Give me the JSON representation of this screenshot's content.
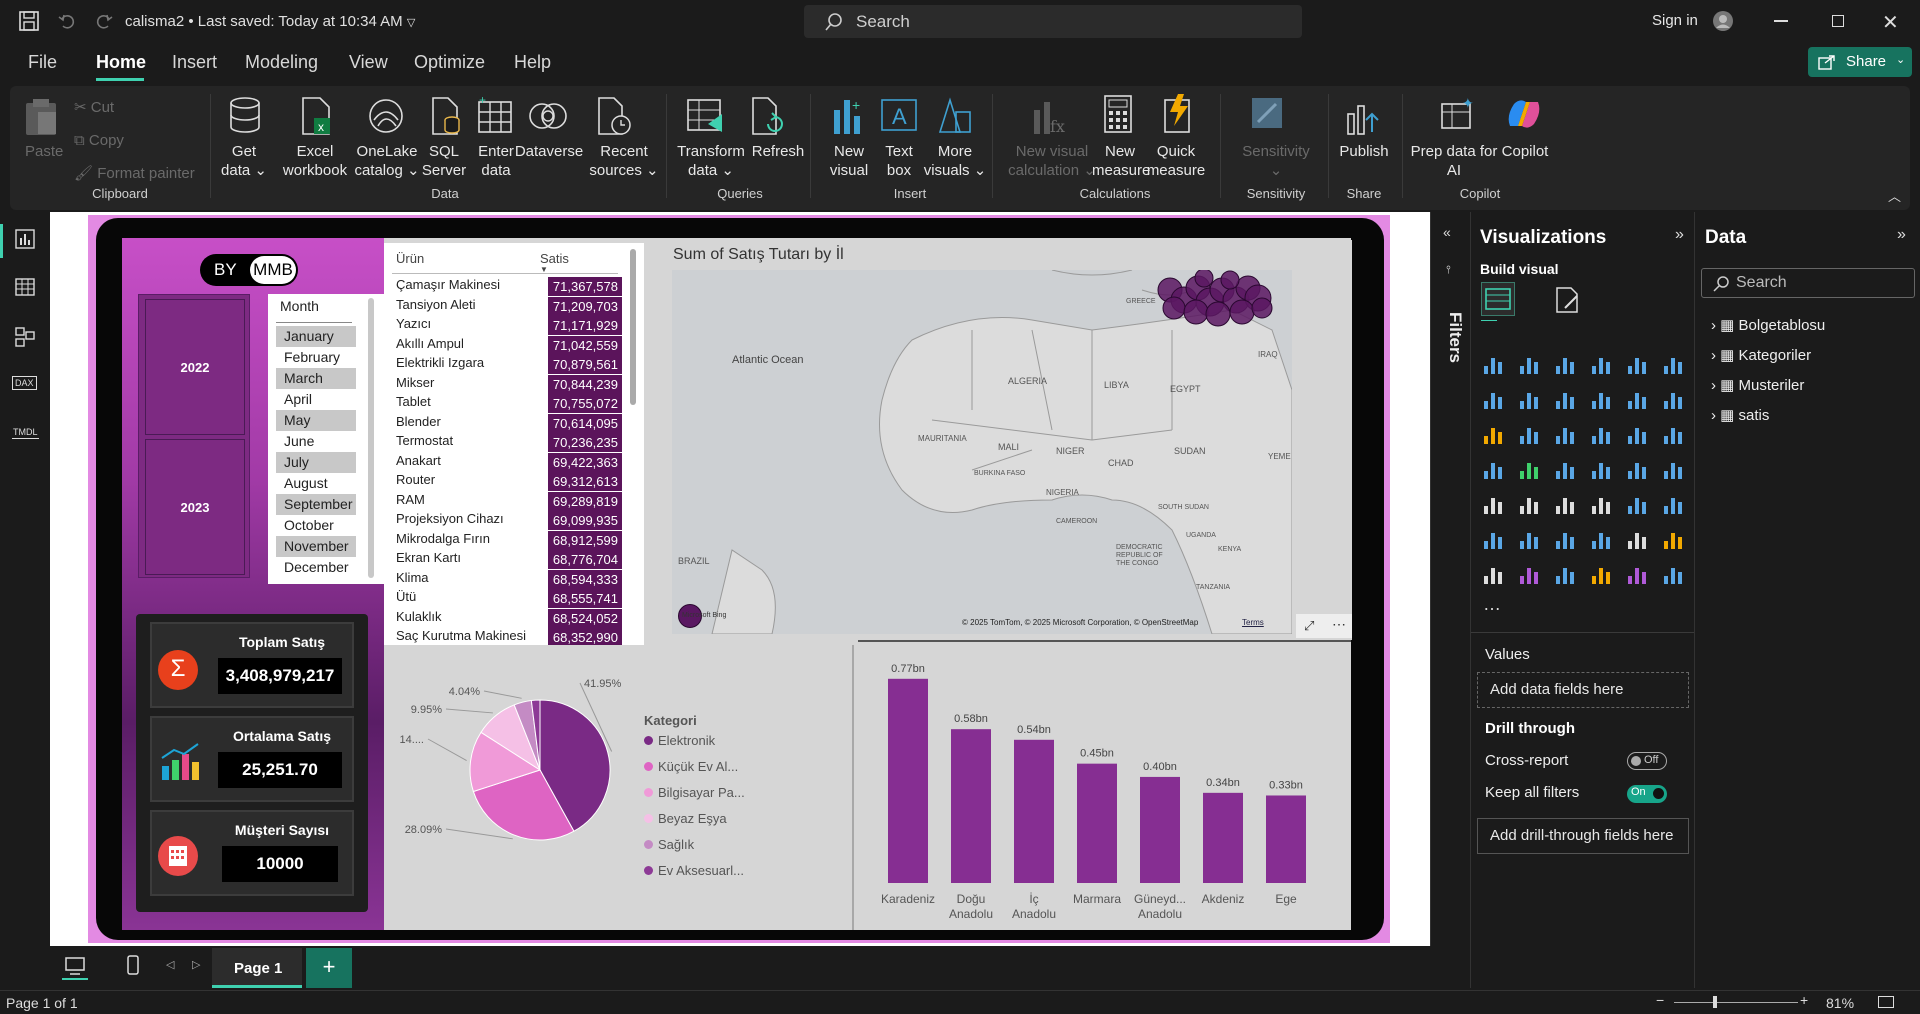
{
  "titlebar": {
    "filename": "calisma2",
    "saved": "Last saved: Today at 10:34 AM",
    "search_placeholder": "Search",
    "signin": "Sign in"
  },
  "menu": {
    "items": [
      "File",
      "Home",
      "Insert",
      "Modeling",
      "View",
      "Optimize",
      "Help"
    ],
    "active": "Home",
    "share": "Share"
  },
  "ribbon": {
    "clipboard": {
      "paste": "Paste",
      "cut": "Cut",
      "copy": "Copy",
      "format_painter": "Format painter",
      "group": "Clipboard"
    },
    "data": {
      "get_data": [
        "Get",
        "data"
      ],
      "excel": [
        "Excel",
        "workbook"
      ],
      "onelake": [
        "OneLake",
        "catalog"
      ],
      "sql": [
        "SQL",
        "Server"
      ],
      "enter": [
        "Enter",
        "data"
      ],
      "dataverse": "Dataverse",
      "recent": [
        "Recent",
        "sources"
      ],
      "group": "Data"
    },
    "queries": {
      "transform": [
        "Transform",
        "data"
      ],
      "refresh": "Refresh",
      "group": "Queries"
    },
    "insert": {
      "new_visual": [
        "New",
        "visual"
      ],
      "text_box": [
        "Text",
        "box"
      ],
      "more_visuals": [
        "More",
        "visuals"
      ],
      "group": "Insert"
    },
    "calculations": {
      "new_visual_calc": [
        "New visual",
        "calculation"
      ],
      "new_measure": [
        "New",
        "measure"
      ],
      "quick_measure": [
        "Quick",
        "measure"
      ],
      "group": "Calculations"
    },
    "sensitivity": {
      "label": "Sensitivity",
      "group": "Sensitivity"
    },
    "share": {
      "publish": "Publish",
      "group": "Share"
    },
    "copilot": {
      "prep": [
        "Prep data for",
        "AI"
      ],
      "copilot": "Copilot",
      "group": "Copilot"
    }
  },
  "report": {
    "toggle": {
      "left": "BY",
      "right": "MMB"
    },
    "years": [
      "2022",
      "2023"
    ],
    "month_header": "Month",
    "months": [
      "January",
      "February",
      "March",
      "April",
      "May",
      "June",
      "July",
      "August",
      "September",
      "October",
      "November",
      "December"
    ],
    "kpis": [
      {
        "title": "Toplam Satış",
        "value": "3,408,979,217"
      },
      {
        "title": "Ortalama Satış",
        "value": "25,251.70"
      },
      {
        "title": "Müşteri Sayısı",
        "value": "10000"
      }
    ],
    "table": {
      "col1": "Ürün",
      "col2": "Satis",
      "rows": [
        [
          "Çamaşır Makinesi",
          "71,367,578"
        ],
        [
          "Tansiyon Aleti",
          "71,209,703"
        ],
        [
          "Yazıcı",
          "71,171,929"
        ],
        [
          "Akıllı Ampul",
          "71,042,559"
        ],
        [
          "Elektrikli Izgara",
          "70,879,561"
        ],
        [
          "Mikser",
          "70,844,239"
        ],
        [
          "Tablet",
          "70,755,072"
        ],
        [
          "Blender",
          "70,614,095"
        ],
        [
          "Termostat",
          "70,236,235"
        ],
        [
          "Anakart",
          "69,422,363"
        ],
        [
          "Router",
          "69,312,613"
        ],
        [
          "RAM",
          "69,289,819"
        ],
        [
          "Projeksiyon Cihazı",
          "69,099,935"
        ],
        [
          "Mikrodalga Fırın",
          "68,912,599"
        ],
        [
          "Ekran Kartı",
          "68,776,704"
        ],
        [
          "Klima",
          "68,594,333"
        ],
        [
          "Ütü",
          "68,555,741"
        ],
        [
          "Kulaklık",
          "68,524,052"
        ],
        [
          "Saç Kurutma Makinesi",
          "68,352,990"
        ]
      ]
    },
    "map": {
      "title": "Sum of Satış Tutarı by İl",
      "labels": [
        "Atlantic Ocean",
        "ALGERIA",
        "LIBYA",
        "EGYPT",
        "MAURITANIA",
        "MALI",
        "NIGER",
        "CHAD",
        "SUDAN",
        "BURKINA FASO",
        "NIGERIA",
        "SOUTH SUDAN",
        "CAMEROON",
        "UGANDA",
        "KENYA",
        "DEMOCRATIC REPUBLIC OF THE CONGO",
        "TANZANIA",
        "BRAZIL",
        "GREECE",
        "IRAQ",
        "YEME"
      ],
      "attribution": "© 2025 TomTom, © 2025 Microsoft Corporation, © OpenStreetMap",
      "terms": "Terms",
      "bing": "Microsoft Bing"
    },
    "pie": {
      "legend_title": "Kategori",
      "labels": [
        "41.95%",
        "28.09%",
        "14....",
        "9.95%",
        "4.04%"
      ]
    },
    "bar_labels": [
      [
        "Karadeniz"
      ],
      [
        "Doğu",
        "Anadolu"
      ],
      [
        "İç",
        "Anadolu"
      ],
      [
        "Marmara"
      ],
      [
        "Güneyd...",
        "Anadolu"
      ],
      [
        "Akdeniz"
      ],
      [
        "Ege"
      ]
    ]
  },
  "chart_data": [
    {
      "type": "pie",
      "categories": [
        "Elektronik",
        "Küçük Ev Al...",
        "Bilgisayar Pa...",
        "Beyaz Eşya",
        "Sağlık",
        "Ev Aksesuarl..."
      ],
      "values": [
        41.95,
        28.09,
        14.0,
        9.95,
        4.04,
        1.97
      ],
      "value_labels": [
        "41.95%",
        "28.09%",
        "14....",
        "9.95%",
        "4.04%",
        ""
      ],
      "colors": [
        "#7a2a85",
        "#de64c3",
        "#f09ad8",
        "#f5c0e6",
        "#c48bc4",
        "#8d3a96"
      ],
      "legend": "right"
    },
    {
      "type": "bar",
      "categories": [
        "Karadeniz",
        "Doğu Anadolu",
        "İç Anadolu",
        "Marmara",
        "Güneydoğu Anadolu",
        "Akdeniz",
        "Ege"
      ],
      "values": [
        0.77,
        0.58,
        0.54,
        0.45,
        0.4,
        0.34,
        0.33
      ],
      "value_labels": [
        "0.77bn",
        "0.58bn",
        "0.54bn",
        "0.45bn",
        "0.40bn",
        "0.34bn",
        "0.33bn"
      ],
      "unit": "bn",
      "color": "#862e92",
      "ylim": [
        0,
        0.8
      ]
    }
  ],
  "panes": {
    "filters": "Filters",
    "visualizations": {
      "title": "Visualizations",
      "build": "Build visual",
      "values": "Values",
      "add_fields": "Add data fields here",
      "drill": "Drill through",
      "cross_report": "Cross-report",
      "cross_state": "Off",
      "keep_filters": "Keep all filters",
      "keep_state": "On",
      "add_drill": "Add drill-through fields here"
    },
    "data": {
      "title": "Data",
      "search": "Search",
      "tables": [
        "Bolgetablosu",
        "Kategoriler",
        "Musteriler",
        "satis"
      ]
    }
  },
  "pages": {
    "current": "Page 1"
  },
  "status": {
    "page": "Page 1 of 1",
    "zoom": "81%"
  }
}
